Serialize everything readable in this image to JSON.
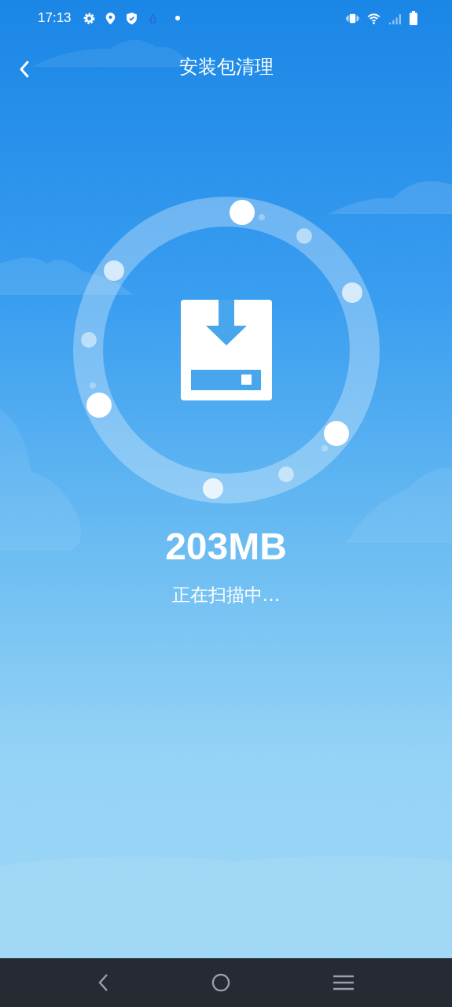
{
  "status_bar": {
    "time": "17:13"
  },
  "header": {
    "title": "安装包清理"
  },
  "scan": {
    "size": "203MB",
    "status": "正在扫描中…"
  }
}
